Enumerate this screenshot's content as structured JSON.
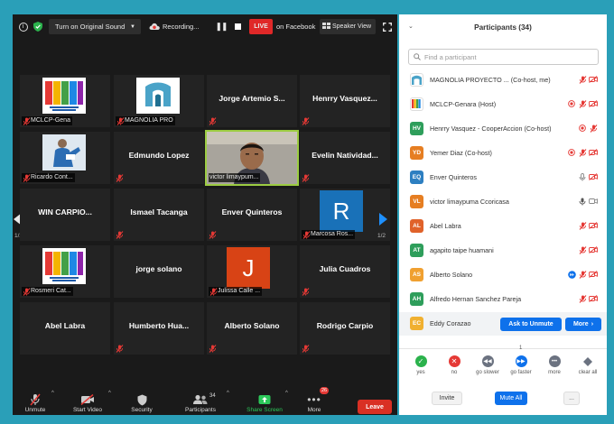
{
  "topbar": {
    "original_sound_label": "Turn on Original Sound",
    "recording_label": "Recording...",
    "live_label": "LIVE",
    "facebook_label": "on Facebook",
    "speaker_view_label": "Speaker View"
  },
  "gallery": {
    "page_indicator_left": "1/2",
    "page_indicator_right": "1/2",
    "tiles": [
      {
        "name": "",
        "label": "MCLCP-Gena"
      },
      {
        "name": "",
        "label": "MAGNOLIA PRO"
      },
      {
        "name": "Jorge Artemio S...",
        "label": ""
      },
      {
        "name": "Henrry Vasquez...",
        "label": ""
      },
      {
        "name": "",
        "label": "Ricardo Cont..."
      },
      {
        "name": "Edmundo Lopez",
        "label": ""
      },
      {
        "name": "",
        "label": "victor limaypum..."
      },
      {
        "name": "Evelin Natividad...",
        "label": ""
      },
      {
        "name": "WIN CARPIO...",
        "label": ""
      },
      {
        "name": "Ismael Tacanga",
        "label": ""
      },
      {
        "name": "Enver Quinteros",
        "label": ""
      },
      {
        "name": "",
        "label": "Marcosa Ros...",
        "avatar": "R"
      },
      {
        "name": "",
        "label": "Rosmeri Cat..."
      },
      {
        "name": "jorge solano",
        "label": ""
      },
      {
        "name": "",
        "label": "Julissa Calle ...",
        "avatar": "J"
      },
      {
        "name": "Julia Cuadros",
        "label": ""
      },
      {
        "name": "Abel Labra",
        "label": ""
      },
      {
        "name": "Humberto Hua...",
        "label": ""
      },
      {
        "name": "Alberto Solano",
        "label": ""
      },
      {
        "name": "Rodrigo Carpio",
        "label": ""
      }
    ]
  },
  "toolbar": {
    "unmute": "Unmute",
    "start_video": "Start Video",
    "security": "Security",
    "participants": "Participants",
    "participants_count": "34",
    "share_screen": "Share Screen",
    "more": "More",
    "more_badge": "26",
    "leave": "Leave"
  },
  "panel": {
    "title": "Participants (34)",
    "search_placeholder": "Find a participant",
    "participants": [
      {
        "initials": "",
        "name": "MAGNOLIA PROYECTO ... (Co-host, me)",
        "color": "#ffffff"
      },
      {
        "initials": "",
        "name": "MCLCP-Genara (Host)",
        "color": "#ffffff"
      },
      {
        "initials": "HV",
        "name": "Henrry Vasquez - CooperAccion (Co-host)",
        "color": "#2e9e5b"
      },
      {
        "initials": "YD",
        "name": "Yemer Diaz (Co-host)",
        "color": "#e67e22"
      },
      {
        "initials": "EQ",
        "name": "Enver Quinteros",
        "color": "#2d7fc1"
      },
      {
        "initials": "VL",
        "name": "victor limaypuma Ccoricasa",
        "color": "#e67e22"
      },
      {
        "initials": "AL",
        "name": "Abel Labra",
        "color": "#e0622a"
      },
      {
        "initials": "AT",
        "name": "agapito taipe huamani",
        "color": "#2e9e5b"
      },
      {
        "initials": "AS",
        "name": "Alberto Solano",
        "color": "#f0a030"
      },
      {
        "initials": "AH",
        "name": "Alfredo Hernan Sanchez Pareja",
        "color": "#2e9e5b"
      },
      {
        "initials": "EC",
        "name": "Eddy Corazao",
        "color": "#f0b030"
      }
    ],
    "ask_to_unmute": "Ask to Unmute",
    "more_label": "More",
    "reaction_count": "1",
    "reactions": [
      {
        "label": "yes",
        "icon": "check-icon",
        "color": "#2bb24c"
      },
      {
        "label": "no",
        "icon": "x-icon",
        "color": "#e53935"
      },
      {
        "label": "go slower",
        "icon": "rewind-icon",
        "color": "#6b7280"
      },
      {
        "label": "go faster",
        "icon": "fast-forward-icon",
        "color": "#0e71eb"
      },
      {
        "label": "more",
        "icon": "more-dots-icon",
        "color": "#6b7280"
      },
      {
        "label": "clear all",
        "icon": "clear-all-icon",
        "color": "#6b7280"
      }
    ],
    "invite": "Invite",
    "mute_all": "Mute All",
    "dots": "..."
  }
}
